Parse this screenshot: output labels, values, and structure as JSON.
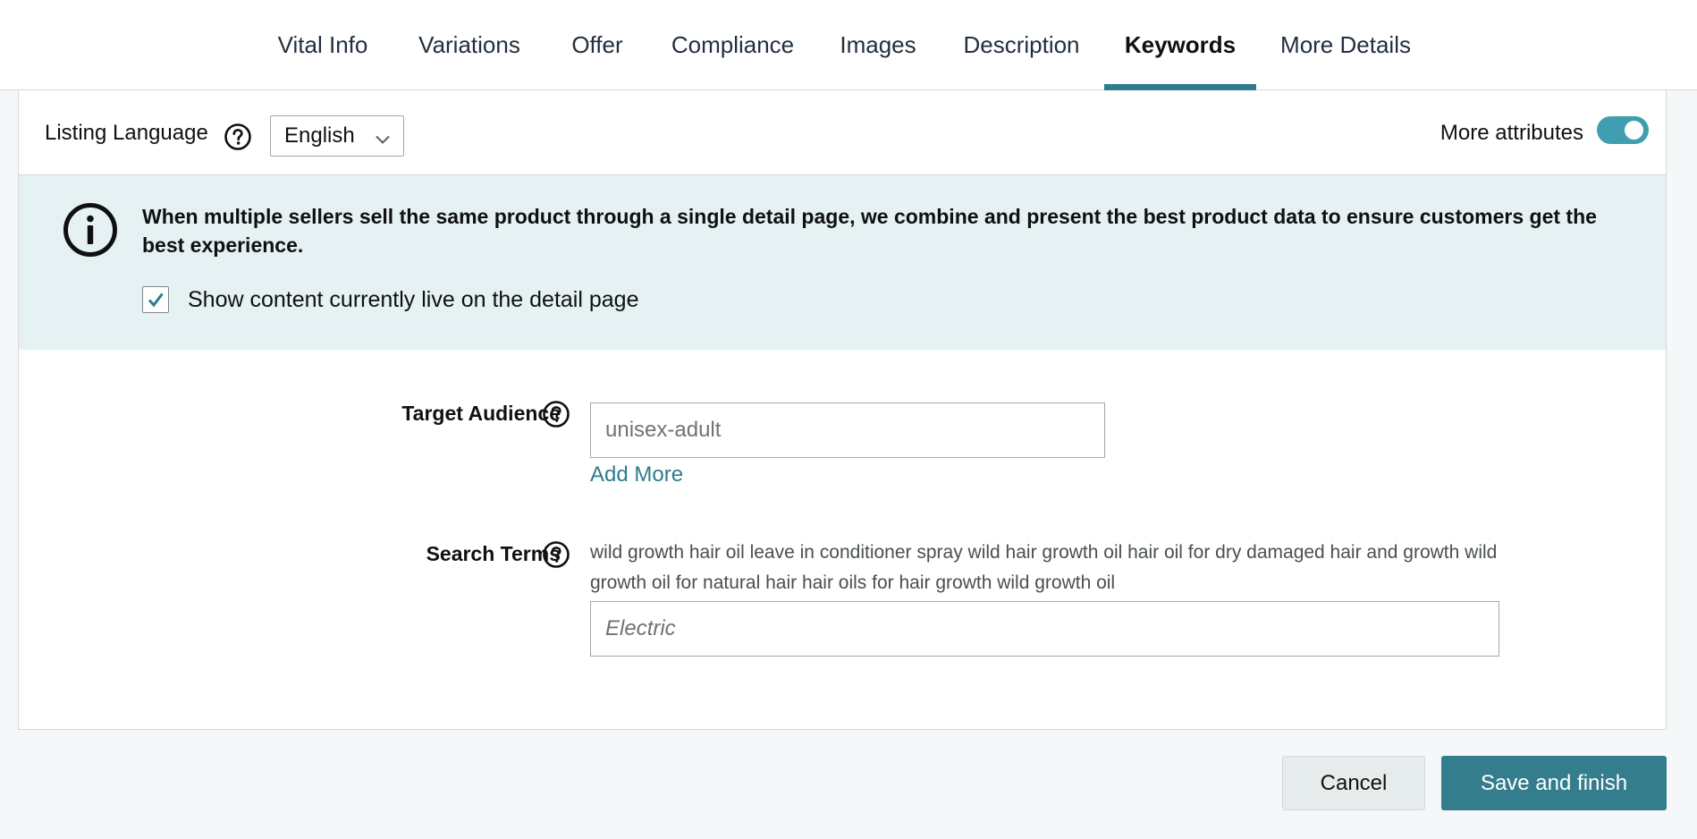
{
  "tabs": [
    {
      "label": "Vital Info",
      "active": false
    },
    {
      "label": "Variations",
      "active": false
    },
    {
      "label": "Offer",
      "active": false
    },
    {
      "label": "Compliance",
      "active": false
    },
    {
      "label": "Images",
      "active": false
    },
    {
      "label": "Description",
      "active": false
    },
    {
      "label": "Keywords",
      "active": true
    },
    {
      "label": "More Details",
      "active": false
    }
  ],
  "listing_language": {
    "label": "Listing Language",
    "selected": "English",
    "help_icon": "question-circle-icon"
  },
  "more_attributes": {
    "label": "More attributes",
    "enabled": true
  },
  "banner": {
    "icon": "info-circle-icon",
    "message": "When multiple sellers sell the same product through a single detail page, we combine and present the best product data to ensure customers get the best experience.",
    "checkbox_label": "Show content currently live on the detail page",
    "checkbox_checked": true
  },
  "target_audience": {
    "label": "Target Audience",
    "value": "",
    "placeholder": "unisex-adult",
    "add_more": "Add More"
  },
  "search_terms": {
    "label": "Search Terms",
    "live_content": "wild growth hair oil leave in conditioner spray wild hair growth oil hair oil for dry damaged hair and growth wild growth oil for natural hair hair oils for hair growth wild growth oil",
    "value": "",
    "placeholder": "Electric"
  },
  "footer": {
    "cancel_label": "Cancel",
    "save_label": "Save and finish"
  },
  "colors": {
    "accent": "#2e7c8e",
    "banner_bg": "#e6f1f3",
    "toggle_on": "#3f9fb0",
    "save_button": "#347d8d"
  }
}
